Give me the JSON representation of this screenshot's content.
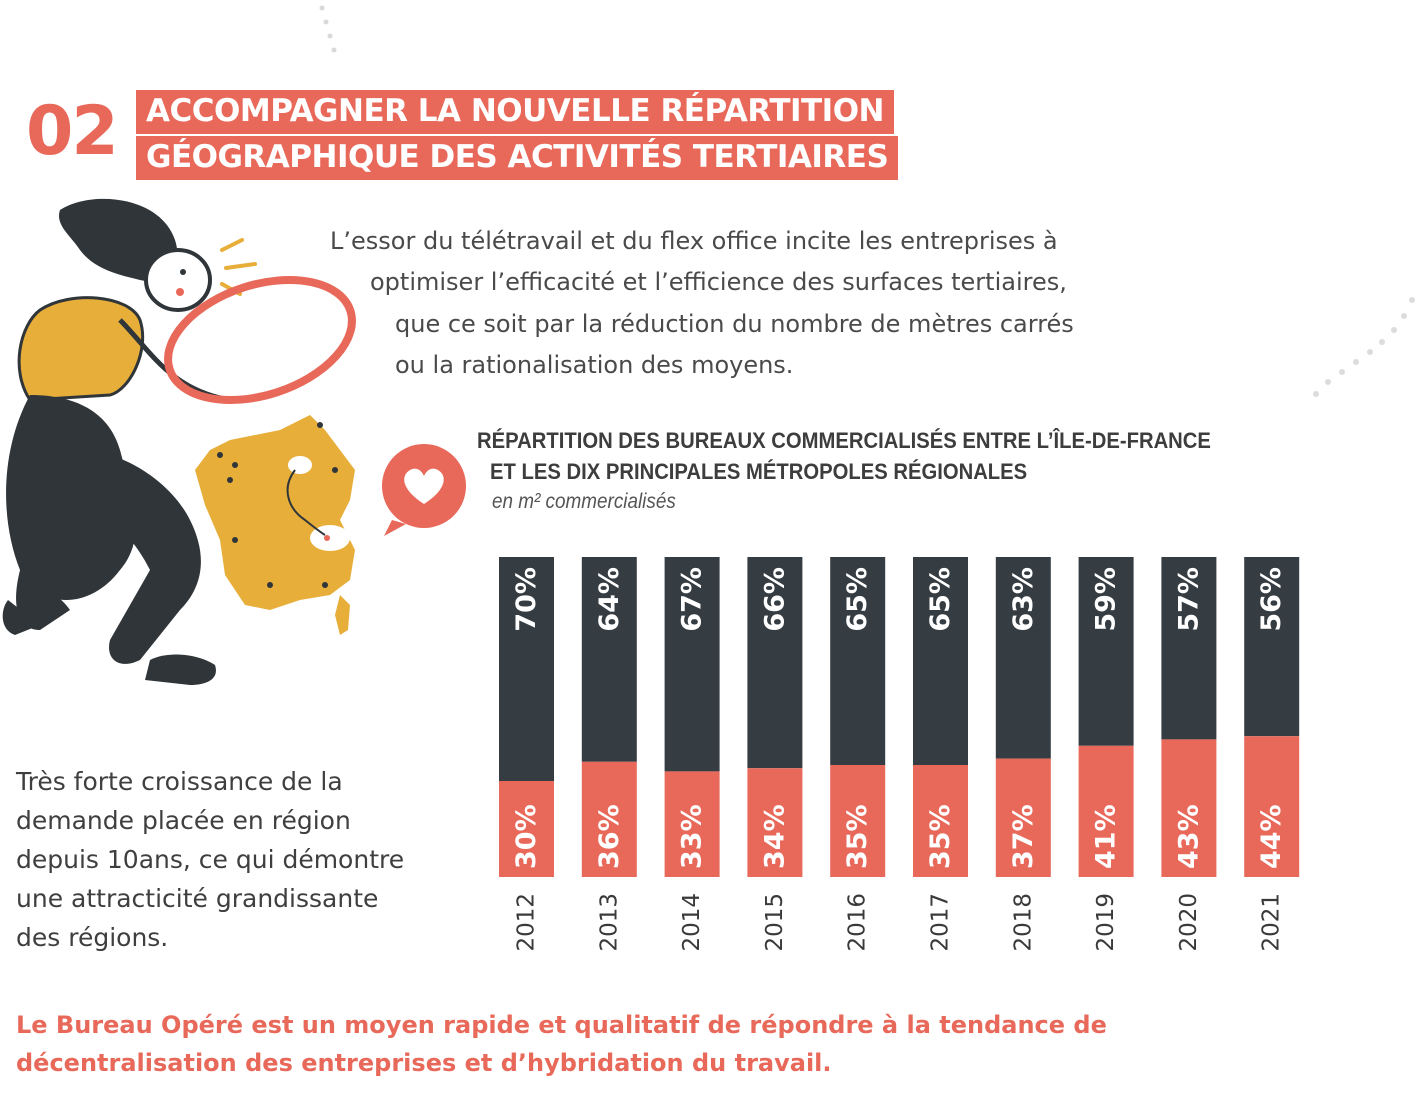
{
  "section": {
    "number": "02",
    "title_line_1": "ACCOMPAGNER LA NOUVELLE RÉPARTITION",
    "title_line_2": "GÉOGRAPHIQUE DES ACTIVITÉS TERTIAIRES"
  },
  "intro": {
    "lines": [
      "L’essor du télétravail et du flex office incite les entreprises à",
      "optimiser l’efficacité et l’efficience des surfaces tertiaires,",
      "que ce soit par la réduction du nombre de mètres carrés",
      "ou la rationalisation des moyens."
    ]
  },
  "side_text": {
    "lines": [
      "Très forte croissance de la",
      "demande placée en région",
      "depuis 10ans, ce qui démontre",
      "une attracticité grandissante",
      "des régions."
    ]
  },
  "footer": {
    "lines": [
      "Le Bureau Opéré est un moyen rapide et qualitatif de répondre à la tendance de",
      "décentralisation des entreprises et d’hybridation du travail."
    ]
  },
  "colors": {
    "accent": "#e8695a",
    "dark": "#363d42",
    "mustard": "#e7ae3a"
  },
  "illustration": {
    "icons": [
      "woman-with-magnifier-illustration",
      "france-map-illustration",
      "heart-speech-bubble-icon"
    ]
  },
  "chart_data": {
    "type": "bar",
    "stacked": true,
    "title_line_1": "RÉPARTITION DES BUREAUX COMMERCIALISÉS ENTRE L’ÎLE-DE-FRANCE",
    "title_line_2": "ET LES DIX PRINCIPALES MÉTROPOLES RÉGIONALES",
    "subtitle": "en m² commercialisés",
    "categories": [
      "2012",
      "2013",
      "2014",
      "2015",
      "2016",
      "2017",
      "2018",
      "2019",
      "2020",
      "2021"
    ],
    "series": [
      {
        "values": [
          30,
          36,
          33,
          34,
          35,
          35,
          37,
          41,
          43,
          44
        ],
        "color": "#e8695a",
        "labels": [
          "30%",
          "36%",
          "33%",
          "34%",
          "35%",
          "35%",
          "37%",
          "41%",
          "43%",
          "44%"
        ]
      },
      {
        "values": [
          70,
          64,
          67,
          66,
          65,
          65,
          63,
          59,
          57,
          56
        ],
        "color": "#363d42",
        "labels": [
          "70%",
          "64%",
          "67%",
          "66%",
          "65%",
          "65%",
          "63%",
          "59%",
          "57%",
          "56%"
        ]
      }
    ],
    "ylim": [
      0,
      100
    ],
    "xlabel": "",
    "ylabel": "",
    "grid": false,
    "legend": "none"
  }
}
